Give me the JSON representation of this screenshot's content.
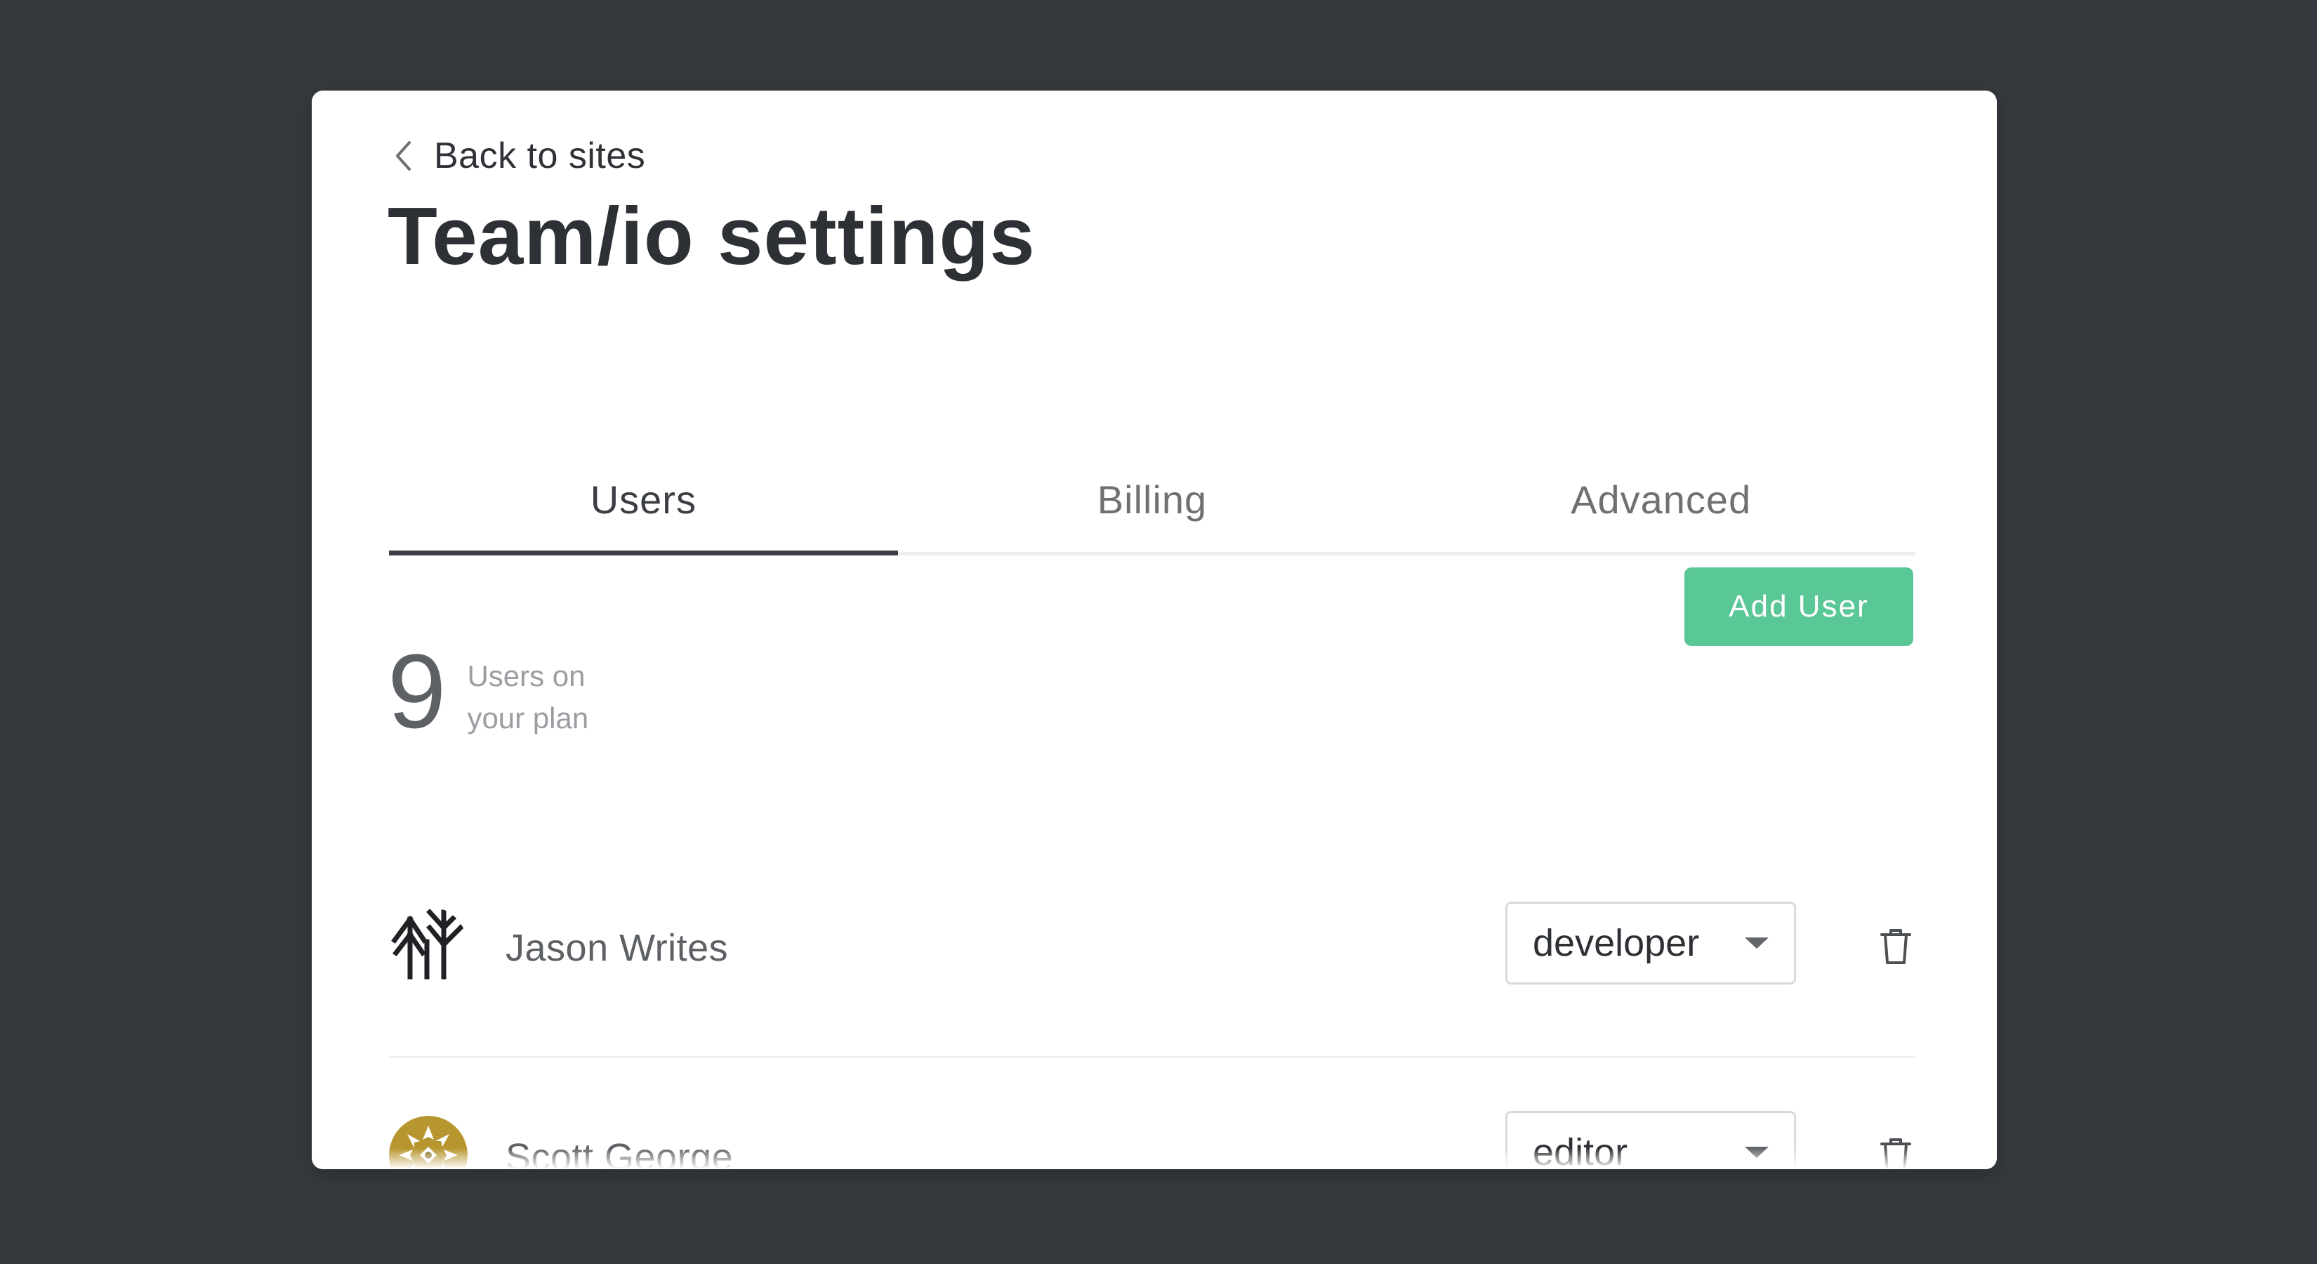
{
  "page": {
    "title": "Team/io settings",
    "back_link": "Back to sites"
  },
  "tabs": [
    {
      "label": "Users",
      "active": true
    },
    {
      "label": "Billing",
      "active": false
    },
    {
      "label": "Advanced",
      "active": false
    }
  ],
  "summary": {
    "user_count": "9",
    "caption": "Users on your plan"
  },
  "actions": {
    "add_user_label": "Add User"
  },
  "users": [
    {
      "name": "Jason Writes",
      "role": "developer",
      "avatar_icon": "tree-logo-icon"
    },
    {
      "name": "Scott George",
      "role": "editor",
      "avatar_icon": "gold-medallion-icon"
    }
  ],
  "colors": {
    "background": "#363a3f",
    "accent": "#5ac797",
    "text_primary": "#2d3035",
    "avatar_gold": "#b8962f"
  }
}
